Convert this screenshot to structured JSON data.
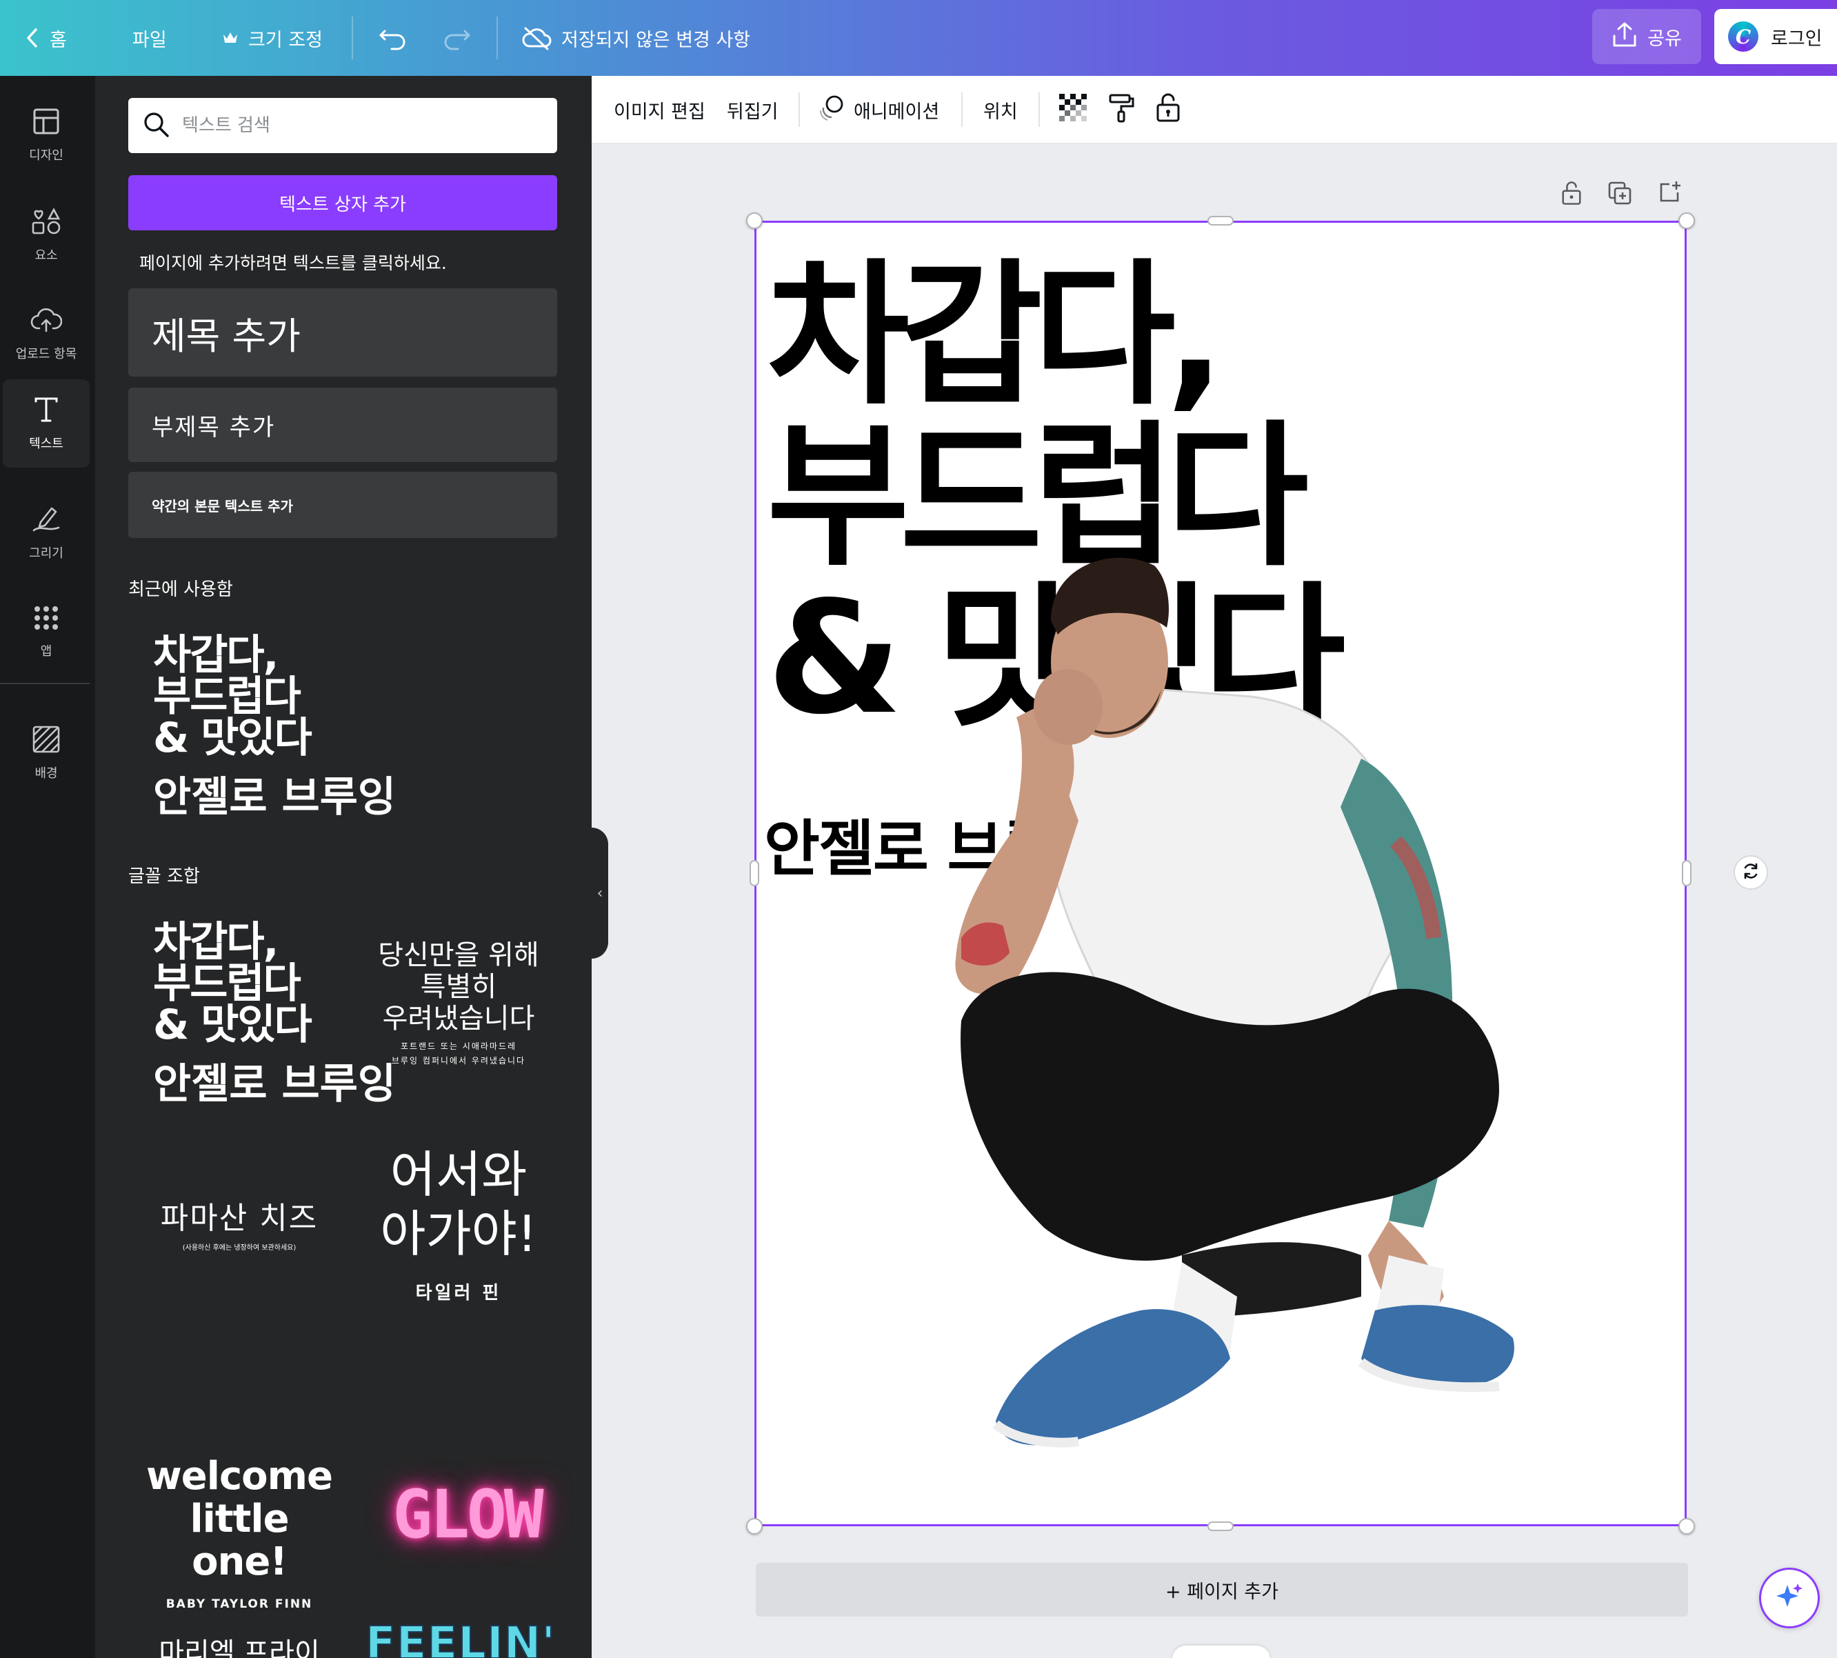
{
  "topbar": {
    "home": "홈",
    "file": "파일",
    "resize": "크기 조정",
    "save_status": "저장되지 않은 변경 사항",
    "share": "공유",
    "login": "로그인",
    "login_logo_letter": "C"
  },
  "rail": [
    {
      "label": "디자인",
      "icon": "layout-icon"
    },
    {
      "label": "요소",
      "icon": "elements-icon"
    },
    {
      "label": "업로드 항목",
      "icon": "upload-cloud-icon"
    },
    {
      "label": "텍스트",
      "icon": "text-icon",
      "active": true
    },
    {
      "label": "그리기",
      "icon": "draw-icon"
    },
    {
      "label": "앱",
      "icon": "apps-icon"
    },
    {
      "label": "배경",
      "icon": "background-icon"
    }
  ],
  "panel": {
    "search_placeholder": "텍스트 검색",
    "add_textbox": "텍스트 상자 추가",
    "hint": "페이지에 추가하려면 텍스트를 클릭하세요.",
    "heading": "제목 추가",
    "subheading": "부제목 추가",
    "body": "약간의 본문 텍스트 추가",
    "recent_label": "최근에 사용함",
    "recent": {
      "lines": [
        "차갑다,",
        "부드럽다",
        "& 맛있다"
      ],
      "sub": "안젤로 브루잉"
    },
    "combos_label": "글꼴 조합",
    "combos": {
      "c1": {
        "lines": [
          "차갑다,",
          "부드럽다",
          "& 맛있다"
        ],
        "sub": "안젤로 브루잉"
      },
      "c2": {
        "lines": [
          "당신만을 위해",
          "특별히",
          "우려냈습니다"
        ],
        "small1": "포트랜드 또는 시애라마드레",
        "small2": "브루잉 컴퍼니에서 우려냈습니다"
      },
      "c3": {
        "title": "파마산 치즈",
        "small": "(사용하신 후에는 냉장하여 보관하세요)"
      },
      "c4": {
        "lines": [
          "어서와",
          "아가야!"
        ],
        "sub": "타일러 핀"
      },
      "c5": {
        "lines": [
          "welcome",
          "little one!"
        ],
        "sub": "BABY TAYLOR FINN"
      },
      "c6": {
        "title": "GLOW"
      },
      "c7": {
        "title": "마리엘 프라이스"
      },
      "c8": {
        "title": "FEELIN'"
      }
    }
  },
  "context_toolbar": {
    "edit_image": "이미지 편집",
    "flip": "뒤집기",
    "animate": "애니메이션",
    "position": "위치"
  },
  "canvas": {
    "headline": [
      "차갑다,",
      "부드럽다",
      "& 맛있다"
    ],
    "subtitle": "안젤로 브루잉",
    "add_page": "+ 페이지 추가"
  },
  "colors": {
    "accent": "#8B3DFF",
    "panel_bg": "#252627",
    "rail_bg": "#18191B",
    "canvas_bg": "#EBECF0"
  }
}
